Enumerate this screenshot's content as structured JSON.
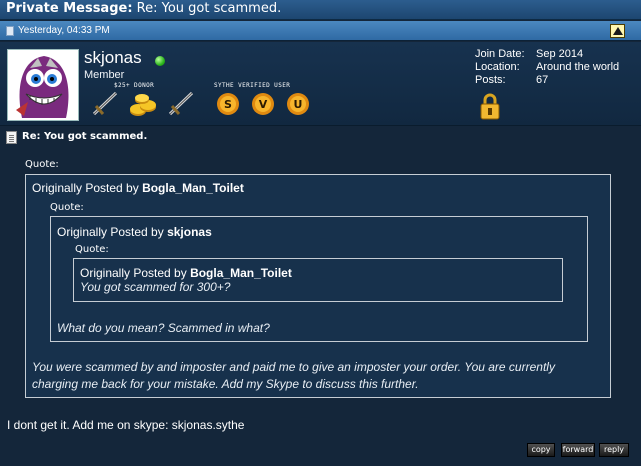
{
  "titlebar": {
    "prefix": "Private Message",
    "title": "Re: You got scammed."
  },
  "datebar": {
    "timestamp": "Yesterday, 04:33 PM"
  },
  "user": {
    "name": "skjonas",
    "role": "Member",
    "badge_labels": {
      "donor": "$25+ DONOR",
      "verified": "SYTHE VERIFIED USER"
    },
    "verified_letters": [
      "S",
      "V",
      "U"
    ],
    "info": {
      "join_date_label": "Join Date:",
      "join_date": "Sep 2014",
      "location_label": "Location:",
      "location": "Around the world",
      "posts_label": "Posts:",
      "posts": "67"
    }
  },
  "post": {
    "subject": "Re: You got scammed.",
    "quote_label": "Quote:",
    "outer_quote": {
      "prefix": "Originally Posted by",
      "author": "Bogla_Man_Toilet",
      "text": "You were scammed by and imposter and paid me to give an imposter your order. You are currently charging me back for your mistake. Add my Skype to discuss this further."
    },
    "middle_quote": {
      "prefix": "Originally Posted by",
      "author": "skjonas",
      "text": "What do you mean? Scammed in what?"
    },
    "inner_quote": {
      "prefix": "Originally Posted by",
      "author": "Bogla_Man_Toilet",
      "text": "You got scammed for 300+?"
    },
    "message": "I dont get it. Add me on skype: skjonas.sythe"
  },
  "buttons": {
    "copy": "copy",
    "forward": "forward",
    "reply": "reply"
  },
  "colors": {
    "background": "#14263a",
    "titlebar": "#2c5d8e",
    "datebar": "#3b78b2",
    "quote_bg": "#17314c",
    "badge_gold": "#f0a81e",
    "online": "#2bb51b"
  }
}
